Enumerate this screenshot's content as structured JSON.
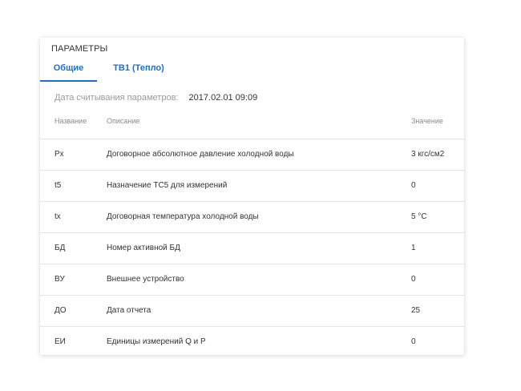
{
  "panel": {
    "title": "ПАРАМЕТРЫ",
    "tabs": [
      {
        "label": "Общие",
        "active": true
      },
      {
        "label": "ТВ1 (Тепло)",
        "active": false
      }
    ],
    "read_label": "Дата считывания параметров:",
    "read_value": "2017.02.01 09:09"
  },
  "table": {
    "headers": {
      "name": "Название",
      "description": "Описание",
      "value": "Значение"
    },
    "rows": [
      {
        "name": "Px",
        "description": "Договорное абсолютное давление холодной воды",
        "value": "3 кгс/см2"
      },
      {
        "name": "t5",
        "description": "Назначение ТС5 для измерений",
        "value": "0"
      },
      {
        "name": "tx",
        "description": "Договорная температура холодной воды",
        "value": "5 °C"
      },
      {
        "name": "БД",
        "description": "Номер активной БД",
        "value": "1"
      },
      {
        "name": "ВУ",
        "description": "Внешнее устройство",
        "value": "0"
      },
      {
        "name": "ДО",
        "description": "Дата отчета",
        "value": "25"
      },
      {
        "name": "ЕИ",
        "description": "Единицы измерений Q и P",
        "value": "0"
      }
    ]
  },
  "colors": {
    "accent": "#1a6fd0",
    "divider": "#e4e4e4",
    "muted": "#9a9a9a"
  }
}
